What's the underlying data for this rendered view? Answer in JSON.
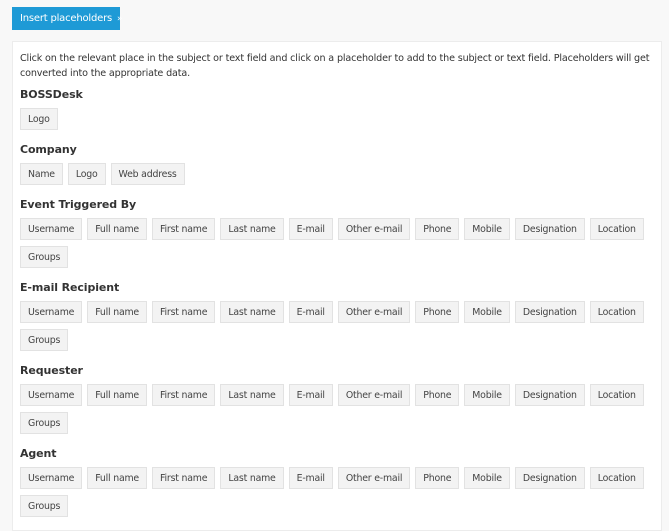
{
  "toolbar": {
    "insert_label": "Insert placeholders",
    "insert_icon": "»"
  },
  "panel": {
    "intro": "Click on the relevant place in the subject or text field and click on a placeholder to add to the subject or text field. Placeholders will get converted into the appropriate data.",
    "groups": [
      {
        "title": "BOSSDesk",
        "items": [
          "Logo"
        ]
      },
      {
        "title": "Company",
        "items": [
          "Name",
          "Logo",
          "Web address"
        ]
      },
      {
        "title": "Event Triggered By",
        "items": [
          "Username",
          "Full name",
          "First name",
          "Last name",
          "E-mail",
          "Other e-mail",
          "Phone",
          "Mobile",
          "Designation",
          "Location",
          "Groups"
        ]
      },
      {
        "title": "E-mail Recipient",
        "items": [
          "Username",
          "Full name",
          "First name",
          "Last name",
          "E-mail",
          "Other e-mail",
          "Phone",
          "Mobile",
          "Designation",
          "Location",
          "Groups"
        ]
      },
      {
        "title": "Requester",
        "items": [
          "Username",
          "Full name",
          "First name",
          "Last name",
          "E-mail",
          "Other e-mail",
          "Phone",
          "Mobile",
          "Designation",
          "Location",
          "Groups"
        ]
      },
      {
        "title": "Agent",
        "items": [
          "Username",
          "Full name",
          "First name",
          "Last name",
          "E-mail",
          "Other e-mail",
          "Phone",
          "Mobile",
          "Designation",
          "Location",
          "Groups"
        ]
      }
    ]
  },
  "colors": {
    "accent": "#1e9ad6",
    "chip_bg": "#f3f3f3",
    "chip_border": "#e2e2e2"
  }
}
